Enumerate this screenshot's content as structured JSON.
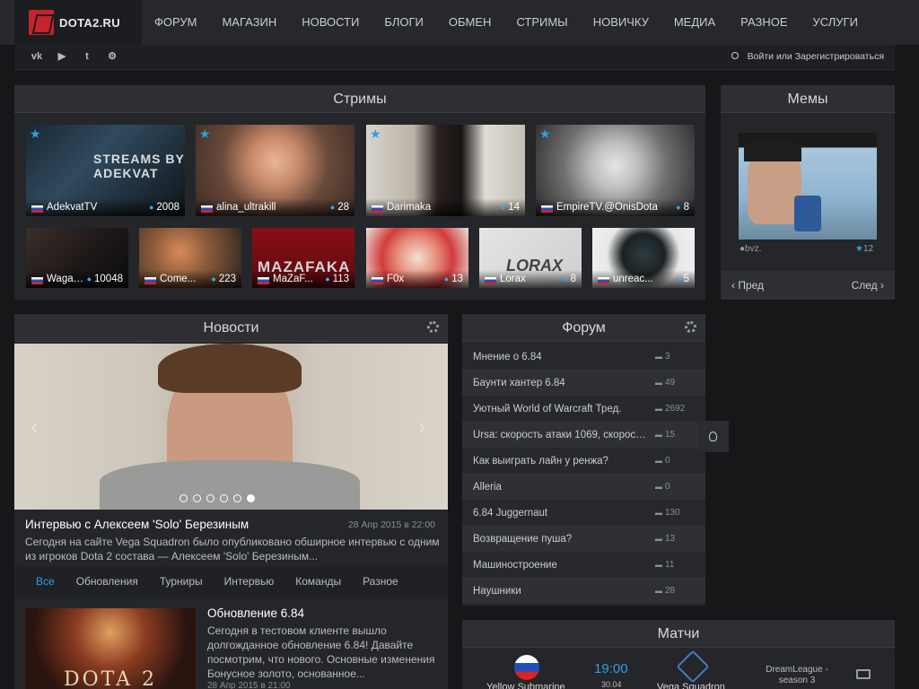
{
  "header": {
    "logo_text": "DOTA2.RU",
    "nav": [
      "ФОРУМ",
      "МАГАЗИН",
      "НОВОСТИ",
      "БЛОГИ",
      "ОБМЕН",
      "СТРИМЫ",
      "НОВИЧКУ",
      "МЕДИА",
      "РАЗНОЕ",
      "УСЛУГИ"
    ],
    "social_icons": [
      "vk-icon",
      "youtube-icon",
      "twitter-icon",
      "steam-icon"
    ],
    "login_text": "Войти или Зарегистрироваться"
  },
  "streams": {
    "title": "Стримы",
    "featured": [
      {
        "name": "AdekvatTV",
        "viewers": "2008",
        "overlay": "STREAMS BY ADEKVAT"
      },
      {
        "name": "alina_ultrakill",
        "viewers": "28"
      },
      {
        "name": "Darimaka",
        "viewers": "14"
      },
      {
        "name": "EmpireTV.@OnisDota",
        "viewers": "8"
      }
    ],
    "small": [
      {
        "name": "Wagam...",
        "viewers": "10048"
      },
      {
        "name": "Come...",
        "viewers": "223"
      },
      {
        "name": "MaZaF...",
        "viewers": "113",
        "overlay": "MAZAFAKA"
      },
      {
        "name": "F0x",
        "viewers": "13"
      },
      {
        "name": "Lorax",
        "viewers": "8",
        "overlay": "LORAX"
      },
      {
        "name": "unreac...",
        "viewers": "5"
      }
    ]
  },
  "memes": {
    "title": "Мемы",
    "author": "bvz.",
    "score": "12",
    "prev": "Пред",
    "next": "След"
  },
  "news": {
    "title": "Новости",
    "featured_title": "Интервью с Алексеем 'Solo' Березиным",
    "featured_date": "28 Апр 2015 в 22:00",
    "featured_text": "Сегодня на сайте Vega Squadron было опубликовано обширное интервью с одним из игроков Dota 2 состава — Алексеем 'Solo' Березиным...",
    "slide_count": 6,
    "active_slide": 6,
    "tabs": [
      "Все",
      "Обновления",
      "Турниры",
      "Интервью",
      "Команды",
      "Разное"
    ],
    "active_tab": "Все",
    "item_title": "Обновление 6.84",
    "item_text": "Сегодня в тестовом клиенте вышло долгожданное обновление 6.84! Давайте посмотрим, что нового. Основные изменения Бонусное золото, основанное...",
    "item_date": "28 Апр 2015 в 21:00",
    "item_thumb_text": "DOTA 2"
  },
  "forum": {
    "title": "Форум",
    "threads": [
      {
        "title": "Мнение о 6.84",
        "count": "3"
      },
      {
        "title": "Баунти хантер 6.84",
        "count": "49"
      },
      {
        "title": "Уютный World of Warcraft Тред.",
        "count": "2692"
      },
      {
        "title": "Ursa: скорость атаки 1069, скорость...",
        "count": "15"
      },
      {
        "title": "Как выиграть лайн у ренжа?",
        "count": "0"
      },
      {
        "title": "Alleria",
        "count": "0"
      },
      {
        "title": "6.84 Juggernaut",
        "count": "130"
      },
      {
        "title": "Возвращение пуша?",
        "count": "13"
      },
      {
        "title": "Машиностроение",
        "count": "11"
      },
      {
        "title": "Наушники",
        "count": "28"
      }
    ]
  },
  "matches": {
    "title": "Матчи",
    "team1": "Yellow Submarine",
    "team2": "Vega Squadron",
    "time": "19:00",
    "date": "30.04",
    "league": "DreamLeague - season 3"
  }
}
